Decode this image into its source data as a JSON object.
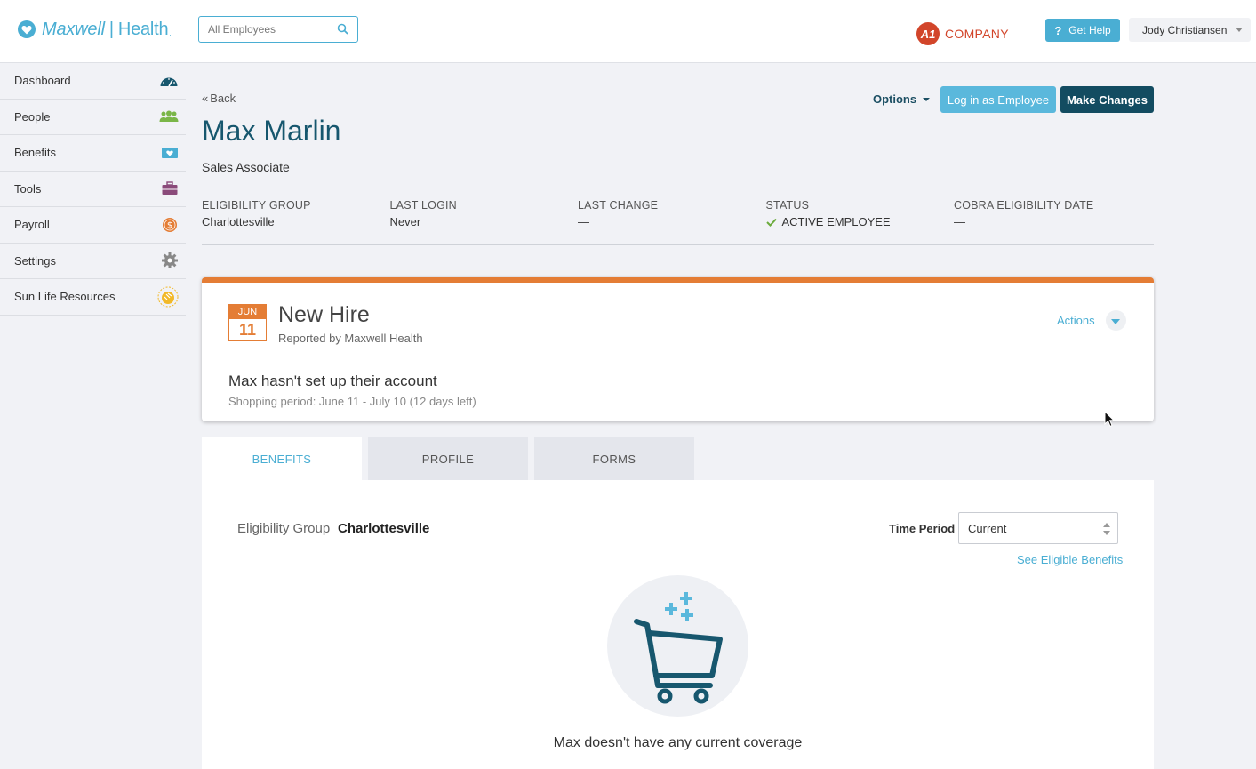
{
  "header": {
    "logo_word1": "Maxwell",
    "logo_sep": "|",
    "logo_word2": "Health",
    "logo_tm": ".",
    "search_placeholder": "All Employees",
    "company_badge": "A1",
    "company_name": "COMPANY",
    "help_icon_text": "?",
    "help_label": "Get Help",
    "user_name": "Jody Christiansen"
  },
  "sidebar": {
    "items": [
      {
        "label": "Dashboard",
        "icon": "gauge-icon"
      },
      {
        "label": "People",
        "icon": "people-icon"
      },
      {
        "label": "Benefits",
        "icon": "heart-card-icon"
      },
      {
        "label": "Tools",
        "icon": "toolbox-icon"
      },
      {
        "label": "Payroll",
        "icon": "dollar-coin-icon"
      },
      {
        "label": "Settings",
        "icon": "gear-icon"
      },
      {
        "label": "Sun Life Resources",
        "icon": "sun-life-icon"
      }
    ]
  },
  "employee": {
    "back_label": "Back",
    "name": "Max Marlin",
    "title": "Sales Associate",
    "options_label": "Options",
    "login_label": "Log in as Employee",
    "make_changes_label": "Make Changes",
    "info": [
      {
        "label": "ELIGIBILITY GROUP",
        "value": "Charlottesville"
      },
      {
        "label": "LAST LOGIN",
        "value": "Never"
      },
      {
        "label": "LAST CHANGE",
        "value": "—"
      },
      {
        "label": "STATUS",
        "value": "ACTIVE EMPLOYEE"
      },
      {
        "label": "COBRA ELIGIBILITY DATE",
        "value": "—"
      }
    ]
  },
  "event": {
    "month": "JUN",
    "day": "11",
    "title": "New Hire",
    "reported_by": "Reported by Maxwell Health",
    "actions_label": "Actions",
    "message": "Max hasn't set up their account",
    "shopping_period": "Shopping period: June 11 - July 10 (12 days left)",
    "accent_color": "#e47d35"
  },
  "tabs": [
    {
      "label": "BENEFITS",
      "active": true
    },
    {
      "label": "PROFILE",
      "active": false
    },
    {
      "label": "FORMS",
      "active": false
    }
  ],
  "benefits": {
    "eligibility_label": "Eligibility Group",
    "eligibility_value": "Charlottesville",
    "time_period_label": "Time Period",
    "time_period_value": "Current",
    "see_eligible_label": "See Eligible Benefits",
    "empty_message": "Max doesn't have any current coverage"
  },
  "colors": {
    "brand": "#4aaed3",
    "dark": "#134c61",
    "company": "#d2452a"
  }
}
